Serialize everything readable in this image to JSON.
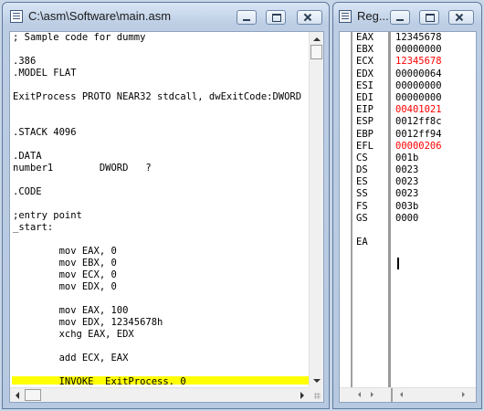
{
  "editor": {
    "title": "C:\\asm\\Software\\main.asm",
    "lines": [
      "; Sample code for dummy",
      "",
      ".386",
      ".MODEL FLAT",
      "",
      "ExitProcess PROTO NEAR32 stdcall, dwExitCode:DWORD",
      "",
      "",
      ".STACK 4096",
      "",
      ".DATA",
      "number1        DWORD   ?",
      "",
      ".CODE",
      "",
      ";entry point",
      "_start:",
      "",
      "        mov EAX, 0",
      "        mov EBX, 0",
      "        mov ECX, 0",
      "        mov EDX, 0",
      "",
      "        mov EAX, 100",
      "        mov EDX, 12345678h",
      "        xchg EAX, EDX",
      "",
      "        add ECX, EAX",
      "",
      "        INVOKE  ExitProcess, 0"
    ],
    "highlighted_line_index": 29,
    "highlight_color": "#ffff00"
  },
  "registers": {
    "title": "Reg...",
    "changed_color": "#ff0000",
    "rows": [
      {
        "name": "EAX",
        "value": "12345678",
        "changed": false
      },
      {
        "name": "EBX",
        "value": "00000000",
        "changed": false
      },
      {
        "name": "ECX",
        "value": "12345678",
        "changed": true
      },
      {
        "name": "EDX",
        "value": "00000064",
        "changed": false
      },
      {
        "name": "ESI",
        "value": "00000000",
        "changed": false
      },
      {
        "name": "EDI",
        "value": "00000000",
        "changed": false
      },
      {
        "name": "EIP",
        "value": "00401021",
        "changed": true
      },
      {
        "name": "ESP",
        "value": "0012ff8c",
        "changed": false
      },
      {
        "name": "EBP",
        "value": "0012ff94",
        "changed": false
      },
      {
        "name": "EFL",
        "value": "00000206",
        "changed": true
      },
      {
        "name": "CS",
        "value": "001b",
        "changed": false
      },
      {
        "name": "DS",
        "value": "0023",
        "changed": false
      },
      {
        "name": "ES",
        "value": "0023",
        "changed": false
      },
      {
        "name": "SS",
        "value": "0023",
        "changed": false
      },
      {
        "name": "FS",
        "value": "003b",
        "changed": false
      },
      {
        "name": "GS",
        "value": "0000",
        "changed": false
      },
      {
        "name": "",
        "value": "",
        "changed": false
      },
      {
        "name": "EA",
        "value": "",
        "changed": false
      }
    ]
  },
  "icons": {
    "window": "document-icon",
    "registers": "registers-icon",
    "minimize": "minimize-icon",
    "maximize": "maximize-icon",
    "close": "close-icon"
  }
}
